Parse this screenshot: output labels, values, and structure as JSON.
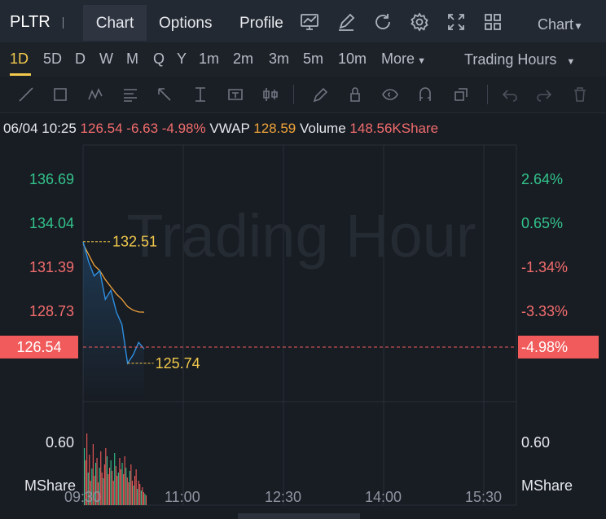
{
  "header": {
    "ticker": "PLTR",
    "tabs": [
      {
        "label": "Chart",
        "active": true
      },
      {
        "label": "Options",
        "active": false
      },
      {
        "label": "Profile",
        "active": false
      }
    ],
    "icons": [
      "indicator-chart-icon",
      "draw-pencil-icon",
      "refresh-icon",
      "settings-gear-icon",
      "fullscreen-icon",
      "layout-grid-icon"
    ],
    "chart_type_label": "Chart"
  },
  "periods": {
    "items": [
      "1D",
      "5D",
      "D",
      "W",
      "M",
      "Q",
      "Y",
      "1m",
      "2m",
      "3m",
      "5m",
      "10m"
    ],
    "active": "1D",
    "more_label": "More",
    "session_label": "Trading Hours"
  },
  "drawing_tools": [
    "trendline-icon",
    "rectangle-icon",
    "wave-icon",
    "fib-lines-icon",
    "arrow-icon",
    "measure-icon",
    "text-icon",
    "candle-icon",
    "pencil-icon",
    "lock-icon",
    "eye-icon",
    "magnet-icon",
    "layers-icon",
    "undo-icon",
    "redo-icon",
    "trash-icon"
  ],
  "info_bar": {
    "datetime": "06/04 10:25",
    "price": "126.54",
    "change": "-6.63",
    "change_pct": "-4.98%",
    "vwap_label": "VWAP",
    "vwap": "128.59",
    "volume_label": "Volume",
    "volume": "148.56KShare"
  },
  "chart": {
    "watermark": "Trading Hour",
    "y_left": [
      "136.69",
      "134.04",
      "131.39",
      "128.73"
    ],
    "y_right": [
      "2.64%",
      "0.65%",
      "-1.34%",
      "-3.33%"
    ],
    "current_price_tag": "126.54",
    "current_pct_tag": "-4.98%",
    "high_label": "132.51",
    "low_label": "125.74",
    "volume_axis_left": "0.60",
    "volume_axis_right": "0.60",
    "volume_unit_left": "MShare",
    "volume_unit_right": "MShare",
    "x_labels": [
      "09:30",
      "11:00",
      "12:30",
      "14:00",
      "15:30"
    ],
    "colors": {
      "up": "#33c48c",
      "down": "#f15b5b",
      "price_line": "#2f8fe0",
      "vwap_line": "#f0a43a",
      "highlight": "#f2c94c"
    }
  },
  "chart_data": {
    "type": "line",
    "x": [
      "09:30",
      "09:35",
      "09:40",
      "09:45",
      "09:50",
      "09:55",
      "10:00",
      "10:05",
      "10:10",
      "10:15",
      "10:20",
      "10:25"
    ],
    "series": [
      {
        "values": [
          132.51,
          131.4,
          130.6,
          130.9,
          129.3,
          129.8,
          128.6,
          127.9,
          125.74,
          126.2,
          126.9,
          126.54
        ]
      },
      {
        "values": [
          132.4,
          131.8,
          131.2,
          130.9,
          130.4,
          130.0,
          129.6,
          129.3,
          128.9,
          128.7,
          128.6,
          128.59
        ]
      }
    ],
    "xlim": [
      "09:30",
      "16:00"
    ],
    "ylim": [
      123.6,
      137.9
    ],
    "grid": true
  }
}
